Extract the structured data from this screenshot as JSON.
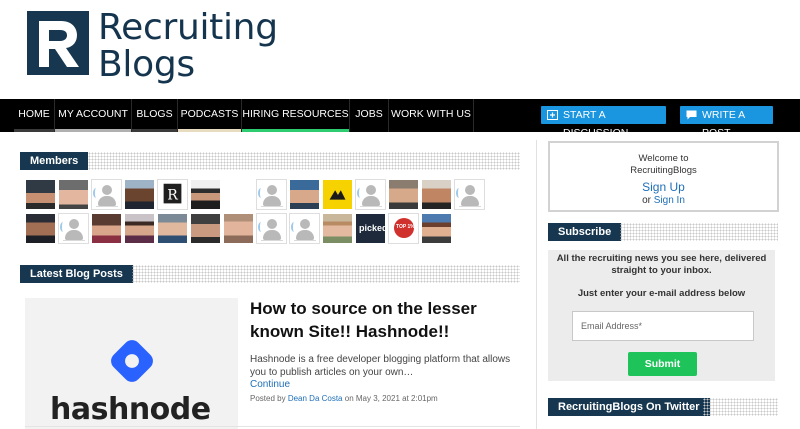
{
  "brand": {
    "line1": "Recruiting",
    "line2": "Blogs",
    "color": "#15354f"
  },
  "nav": {
    "items": [
      {
        "label": "HOME",
        "bar": "#3a3a3a"
      },
      {
        "label": "MY ACCOUNT",
        "bar": "#b0b0b0"
      },
      {
        "label": "BLOGS",
        "bar": "#3a3a3a"
      },
      {
        "label": "PODCASTS",
        "bar": "#e8dcc0"
      },
      {
        "label": "HIRING RESOURCES",
        "bar": "#2ecc71"
      },
      {
        "label": "JOBS",
        "bar": "#000000"
      },
      {
        "label": "WORK WITH US",
        "bar": "#000000"
      }
    ],
    "start_discussion": "START A DISCUSSION",
    "write_post": "WRITE A POST"
  },
  "members": {
    "title": "Members",
    "row1_names": [
      "member",
      "member",
      "member",
      "member",
      "member",
      "member",
      "member",
      "member",
      "member",
      "member",
      "member",
      "member",
      "member",
      "member"
    ],
    "picked_label": "picked",
    "badge_label": "TOP 1%"
  },
  "latest": {
    "title": "Latest Blog Posts"
  },
  "post": {
    "title": "How to source on the lesser known Site!! Hashnode!!",
    "image_word": "hashnode",
    "excerpt": "Hashnode is a free developer blogging platform that allows you to publish articles on your own…",
    "continue": "Continue",
    "posted_by": "Posted by",
    "author": "Dean Da Costa",
    "date": "on May 3, 2021 at 2:01pm"
  },
  "sidebar": {
    "welcome_line1": "Welcome to",
    "welcome_line2": "RecruitingBlogs",
    "sign_up": "Sign Up",
    "or": "or",
    "sign_in": "Sign In",
    "subscribe_title": "Subscribe",
    "subscribe_desc": "All the recruiting news you see here, delivered straight to your inbox.",
    "subscribe_hint": "Just enter your e-mail address below",
    "email_placeholder": "Email Address*",
    "submit": "Submit",
    "twitter_title": "RecruitingBlogs On Twitter"
  },
  "colors": {
    "accent": "#1a95e0",
    "navy": "#16374f",
    "submit": "#1ec45a"
  }
}
